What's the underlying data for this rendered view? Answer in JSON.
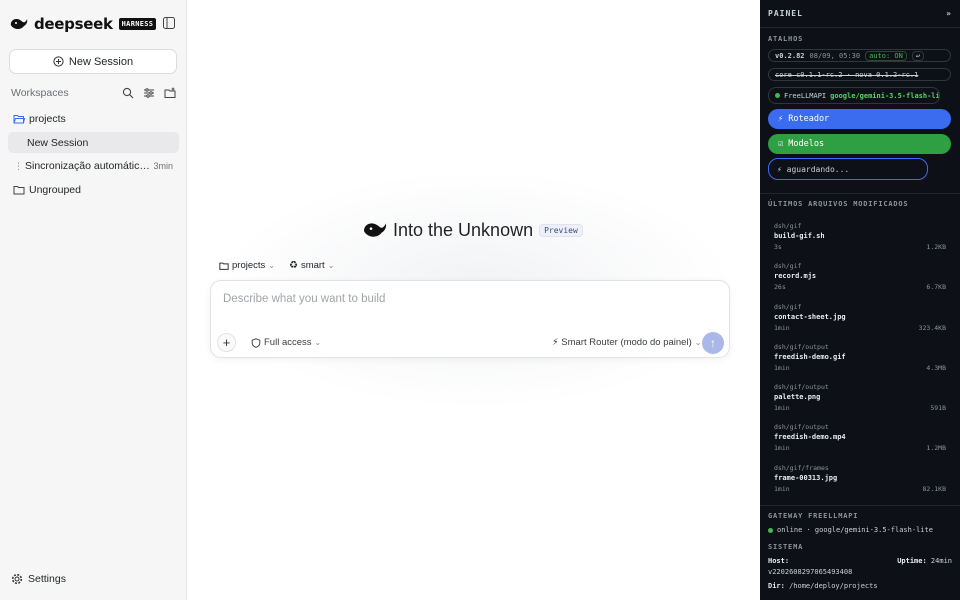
{
  "sidebar": {
    "brand": "deepseek",
    "brand_badge": "HARNESS",
    "new_session_label": "New Session",
    "workspaces_label": "Workspaces",
    "tree": [
      {
        "label": "projects",
        "icon": "folder-open-icon"
      },
      {
        "label": "New Session",
        "active": true
      },
      {
        "label": "Sincronização automática ...",
        "time": "3min",
        "icon": "drag-handle-icon"
      },
      {
        "label": "Ungrouped",
        "icon": "folder-icon"
      }
    ],
    "settings_label": "Settings"
  },
  "main": {
    "title": "Into the Unknown",
    "badge": "Preview",
    "workspace_chip": "projects",
    "mode_chip": "smart",
    "composer": {
      "placeholder": "Describe what you want to build",
      "access_label": "Full access",
      "router_label": "⚡ Smart Router (modo do painel)"
    }
  },
  "panel": {
    "title": "PAINEL",
    "collapse": "»",
    "atalhos_label": "ATALHOS",
    "version": "v0.2.82",
    "datetime": "08/09, 05:30",
    "auto": "auto: ON",
    "undo": "↩",
    "core_line": "core c0.1.1-rc.2 · nova 0.1.2-rc.1",
    "provider": "FreeLLMAPI",
    "model": "google/gemini-3.5-flash-lite",
    "roteador_label": "⚡ Roteador",
    "modelos_label": "☑ Modelos",
    "waiting_label": "⚡ aguardando...",
    "files_label": "ÚLTIMOS ARQUIVOS MODIFICADOS",
    "files": [
      {
        "path": "dsh/gif",
        "name": "build-gif.sh",
        "age": "3s",
        "size": "1.2KB"
      },
      {
        "path": "dsh/gif",
        "name": "record.mjs",
        "age": "26s",
        "size": "6.7KB"
      },
      {
        "path": "dsh/gif",
        "name": "contact-sheet.jpg",
        "age": "1min",
        "size": "323.4KB"
      },
      {
        "path": "dsh/gif/output",
        "name": "freedish-demo.gif",
        "age": "1min",
        "size": "4.3MB"
      },
      {
        "path": "dsh/gif/output",
        "name": "palette.png",
        "age": "1min",
        "size": "591B"
      },
      {
        "path": "dsh/gif/output",
        "name": "freedish-demo.mp4",
        "age": "1min",
        "size": "1.2MB"
      },
      {
        "path": "dsh/gif/frames",
        "name": "frame-00313.jpg",
        "age": "1min",
        "size": "82.1KB"
      }
    ],
    "gateway_label": "GATEWAY FREELLMAPI",
    "gateway_status": "online · google/gemini-3.5-flash-lite",
    "system_label": "SISTEMA",
    "host_label": "Host:",
    "host_value": "v2202608297065493408",
    "uptime_label": "Uptime:",
    "uptime_value": "24min",
    "dir_label": "Dir:",
    "dir_value": "/home/deploy/projects"
  },
  "colors": {
    "accent_blue": "#3b6cf0",
    "accent_green": "#2ea043",
    "panel_bg": "#0d1117"
  }
}
